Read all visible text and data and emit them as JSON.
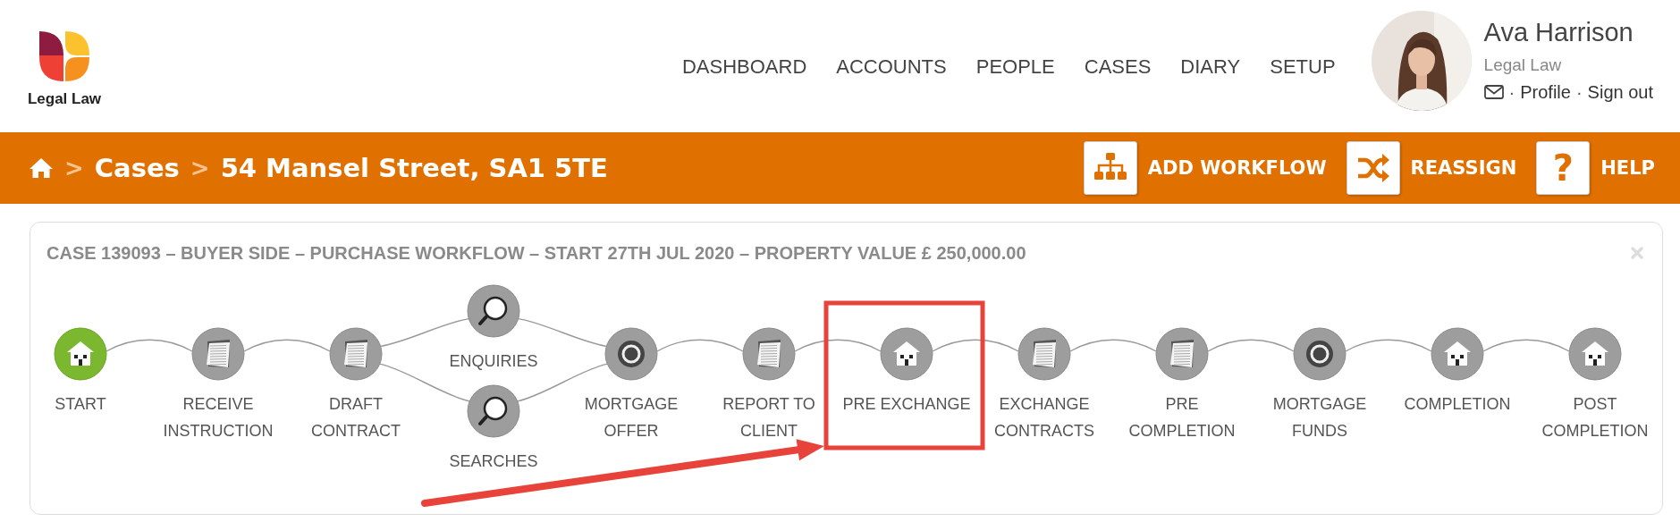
{
  "logo": {
    "text": "Legal Law"
  },
  "nav": [
    {
      "label": "DASHBOARD"
    },
    {
      "label": "ACCOUNTS"
    },
    {
      "label": "PEOPLE"
    },
    {
      "label": "CASES"
    },
    {
      "label": "DIARY"
    },
    {
      "label": "SETUP"
    }
  ],
  "user": {
    "name": "Ava Harrison",
    "organisation": "Legal Law",
    "avatar": {
      "kind": "picture"
    },
    "separator": "·",
    "links": [
      "Profile",
      "Sign out"
    ]
  },
  "breadcrumb": [
    {
      "kind": "home"
    },
    {
      "kind": "link",
      "separator": ">",
      "label": "Cases"
    },
    {
      "kind": "current",
      "separator": ">",
      "label": "54 Mansel Street, SA1 5TE"
    }
  ],
  "actions": [
    {
      "kind": "hierarchy",
      "label": "ADD WORKFLOW"
    },
    {
      "kind": "shuffle",
      "label": "REASSIGN"
    },
    {
      "kind": "glyph",
      "glyph": "?",
      "label": "HELP"
    }
  ],
  "workflow": {
    "title": "CASE 139093 – BUYER SIDE – PURCHASE WORKFLOW – START 27TH JUL 2020 – PROPERTY VALUE £ 250,000.00",
    "steps": [
      {
        "kind": "house",
        "label": "START",
        "done": true,
        "highlighted": false
      },
      {
        "kind": "document",
        "label": "RECEIVE\nINSTRUCTION",
        "done": false,
        "highlighted": false
      },
      {
        "kind": "document",
        "label": "DRAFT\nCONTRACT",
        "done": false,
        "highlighted": false
      },
      {
        "kind": "parallel",
        "branches": [
          {
            "kind": "magnifier",
            "label": "ENQUIRIES",
            "done": false
          },
          {
            "kind": "magnifier",
            "label": "SEARCHES",
            "done": false
          }
        ]
      },
      {
        "kind": "coin",
        "label": "MORTGAGE\nOFFER",
        "done": false,
        "highlighted": false
      },
      {
        "kind": "document",
        "label": "REPORT TO\nCLIENT",
        "done": false,
        "highlighted": false
      },
      {
        "kind": "house",
        "label": "PRE EXCHANGE",
        "done": false,
        "highlighted": true
      },
      {
        "kind": "document",
        "label": "EXCHANGE\nCONTRACTS",
        "done": false,
        "highlighted": false
      },
      {
        "kind": "document",
        "label": "PRE\nCOMPLETION",
        "done": false,
        "highlighted": false
      },
      {
        "kind": "coin",
        "label": "MORTGAGE\nFUNDS",
        "done": false,
        "highlighted": false
      },
      {
        "kind": "house",
        "label": "COMPLETION",
        "done": false,
        "highlighted": false
      },
      {
        "kind": "house",
        "label": "POST\nCOMPLETION",
        "done": false,
        "highlighted": false
      }
    ]
  }
}
